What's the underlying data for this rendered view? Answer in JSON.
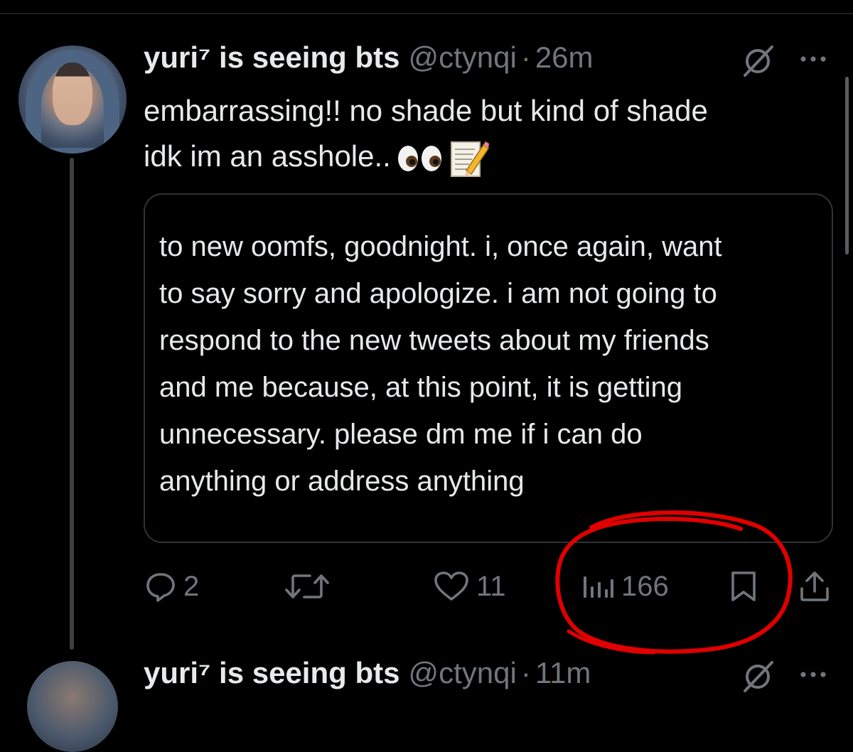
{
  "tweet": {
    "display_name": "yuri⁷ is seeing bts",
    "handle": "@ctynqi",
    "separator": "·",
    "time": "26m",
    "text_lines": [
      "embarrassing!! no shade but kind of shade",
      "idk im an asshole.."
    ],
    "emojis": [
      "eyes-emoji",
      "memo-emoji"
    ],
    "quote": {
      "lines": [
        "to new oomfs, goodnight. i, once again, want",
        "to say sorry and apologize. i am not going to",
        "respond to the new tweets about my friends",
        "and me because, at this point, it is getting",
        "unnecessary. please dm me if i can do",
        "anything or address anything"
      ]
    },
    "actions": {
      "replies": "2",
      "retweets": "",
      "likes": "11",
      "views": "166"
    }
  },
  "next_tweet": {
    "display_name": "yuri⁷ is seeing bts",
    "handle": "@ctynqi",
    "separator": "·",
    "time": "11m"
  },
  "colors": {
    "background": "#000000",
    "text": "#e7e9ea",
    "muted": "#71767b",
    "border": "#2f3336",
    "annotation": "#e00000"
  }
}
